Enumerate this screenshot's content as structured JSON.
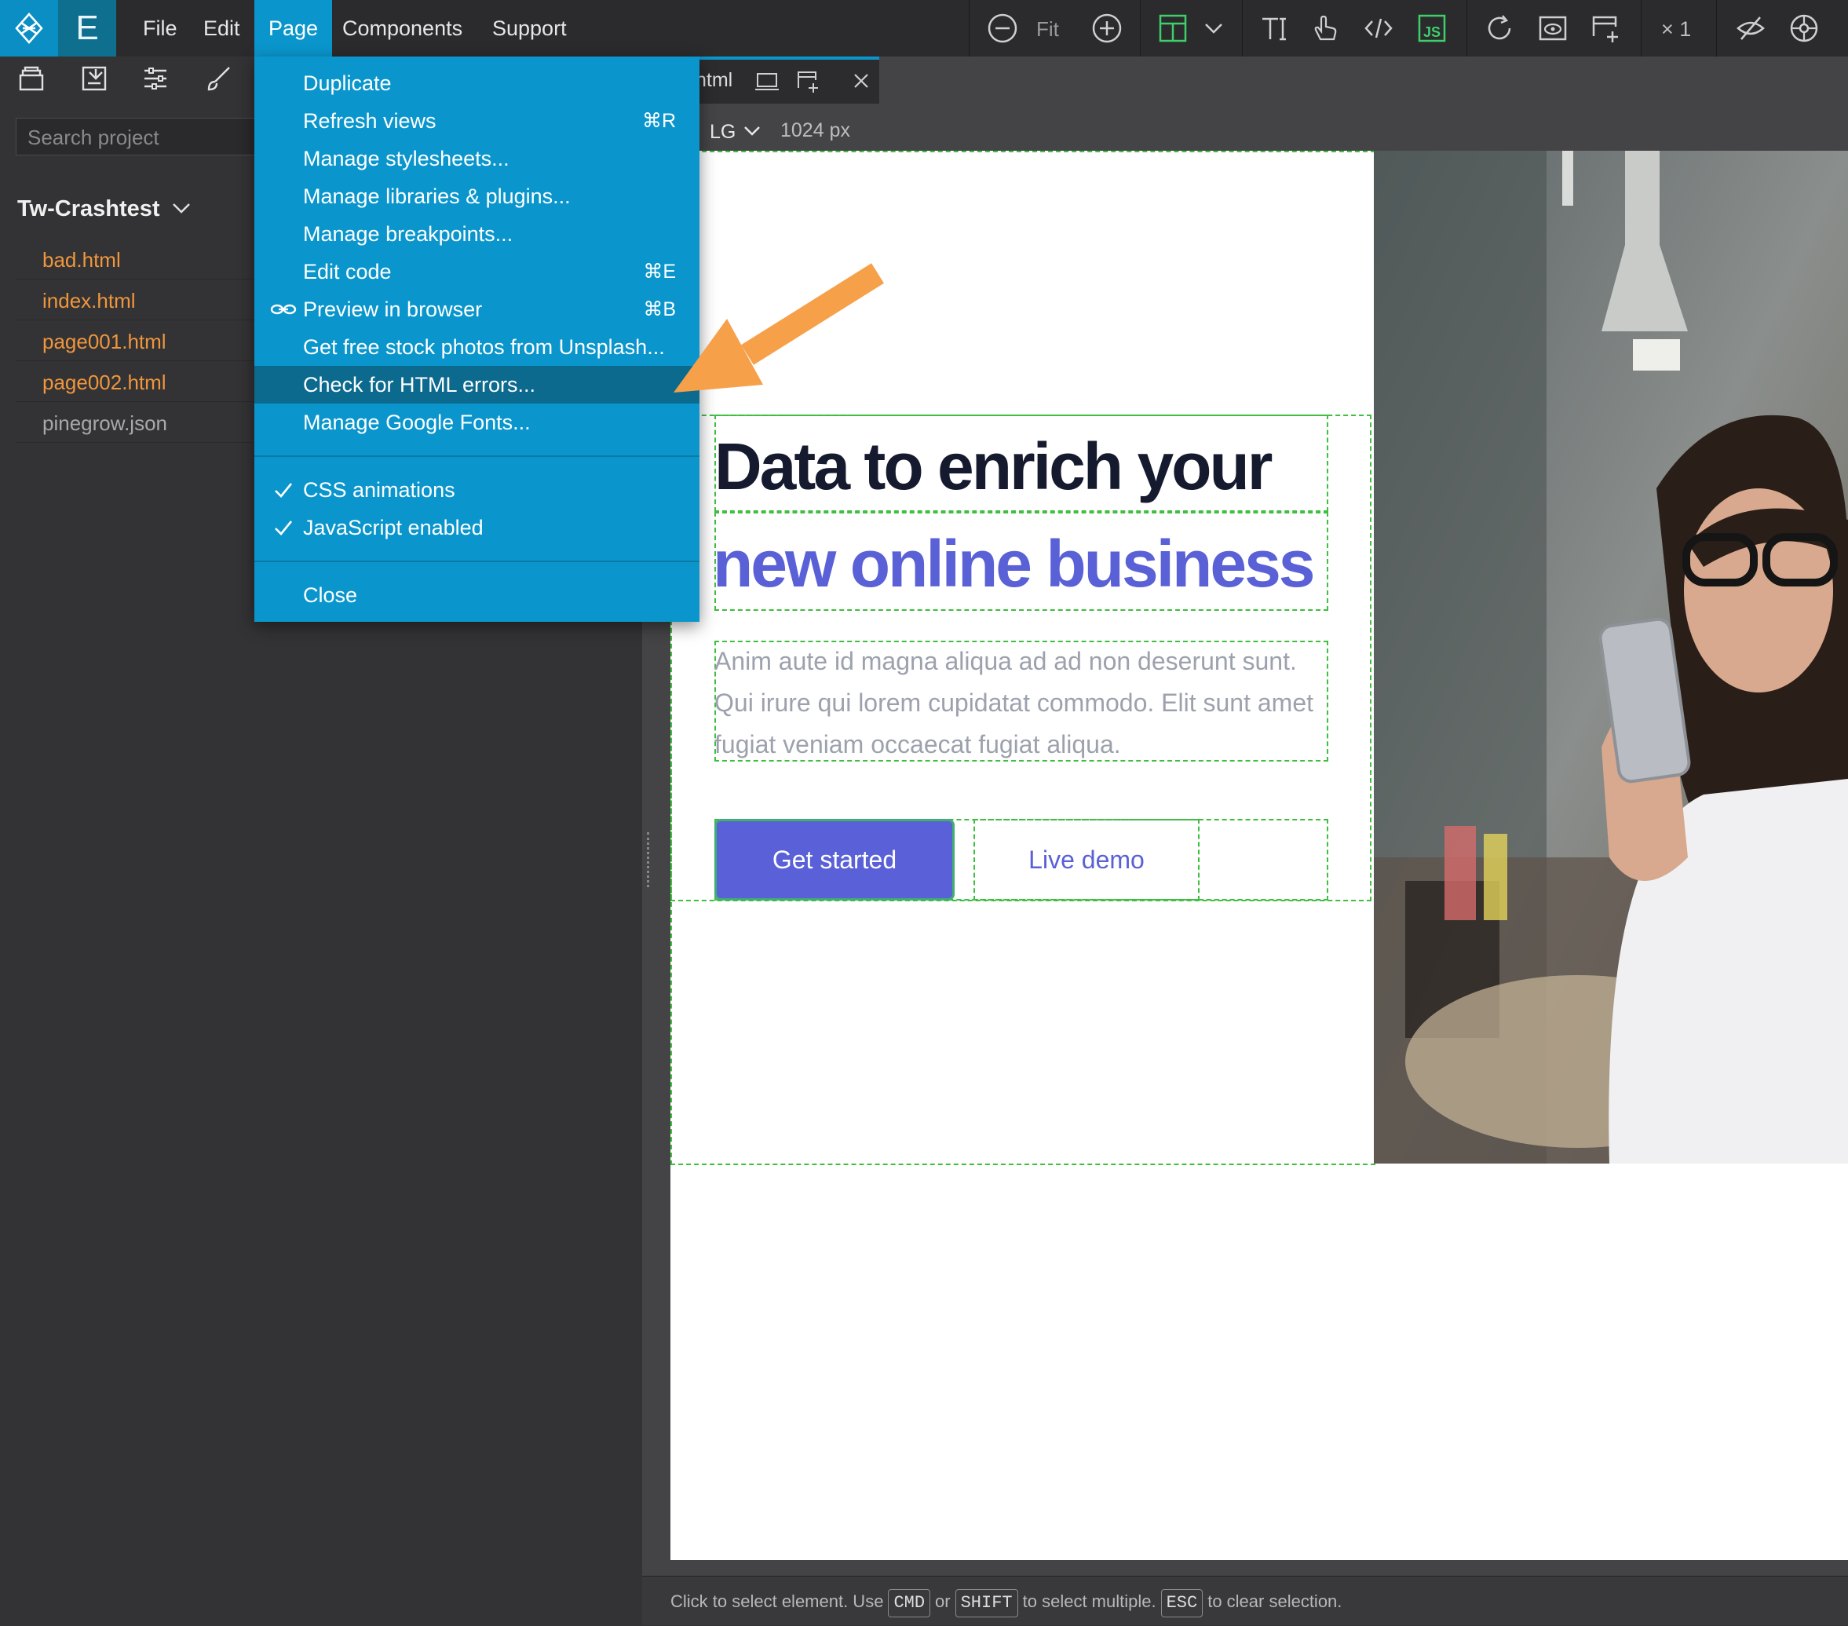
{
  "app": {
    "menus": [
      "File",
      "Edit",
      "Page",
      "Components",
      "Support"
    ],
    "mode_letter": "E",
    "zoom_fit": "Fit",
    "multiplier": "× 1"
  },
  "left_panel": {
    "search_placeholder": "Search project",
    "project_name": "Tw-Crashtest",
    "files": [
      {
        "name": "bad.html",
        "color": "#f0963c"
      },
      {
        "name": "index.html",
        "color": "#f0963c"
      },
      {
        "name": "page001.html",
        "color": "#f0963c"
      },
      {
        "name": "page002.html",
        "color": "#f0963c"
      },
      {
        "name": "pinegrow.json",
        "color": "#a8a8a8"
      }
    ]
  },
  "canvas": {
    "tab_label": "ntml",
    "breakpoint": "LG",
    "width_label": "1024 px"
  },
  "page_menu": {
    "items": [
      {
        "label": "Duplicate",
        "shortcut": ""
      },
      {
        "label": "Refresh views",
        "shortcut": "⌘R"
      },
      {
        "label": "Manage stylesheets...",
        "shortcut": ""
      },
      {
        "label": "Manage libraries & plugins...",
        "shortcut": ""
      },
      {
        "label": "Manage breakpoints...",
        "shortcut": ""
      },
      {
        "label": "Edit code",
        "shortcut": "⌘E"
      },
      {
        "label": "Preview in browser",
        "shortcut": "⌘B"
      },
      {
        "label": "Get free stock photos from Unsplash...",
        "shortcut": ""
      },
      {
        "label": "Check for HTML errors...",
        "shortcut": ""
      },
      {
        "label": "Manage Google Fonts...",
        "shortcut": ""
      }
    ],
    "toggles": [
      {
        "label": "CSS animations",
        "checked": true
      },
      {
        "label": "JavaScript enabled",
        "checked": true
      }
    ],
    "close_label": "Close"
  },
  "hero": {
    "heading_line1": "Data to enrich your",
    "heading_line2": "new online business",
    "paragraph": "Anim aute id magna aliqua ad ad non deserunt sunt. Qui irure qui lorem cupidatat commodo. Elit sunt amet fugiat veniam occaecat fugiat aliqua.",
    "primary_button": "Get started",
    "secondary_button": "Live demo"
  },
  "status_bar": {
    "text1": "Click to select element. Use",
    "key1": "CMD",
    "text2": "or",
    "key2": "SHIFT",
    "text3": "to select multiple.",
    "key3": "ESC",
    "text4": "to clear selection."
  },
  "colors": {
    "accent": "#0a96cc",
    "menu_highlight": "#0b6a8e",
    "brand_indigo": "#5a60d6",
    "annotation_arrow": "#f7a04a",
    "guide_green": "#3fbf3f"
  }
}
